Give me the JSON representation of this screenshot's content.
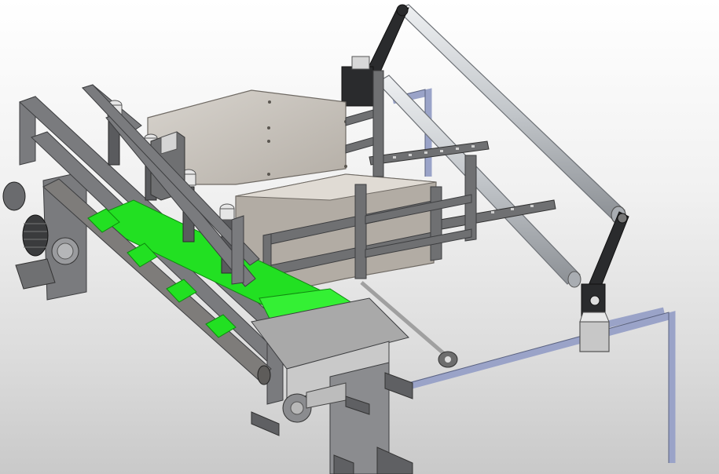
{
  "colors": {
    "background_top": "#ffffff",
    "background_bottom": "#c9c9c9",
    "frame_steel": "#6f7072",
    "frame_dark": "#3d3e40",
    "panel_sheet": "#c9c4bd",
    "roller": "#bfc3c7",
    "belt_green": "#22e022",
    "rail_blue_steel": "#9aa3c8",
    "arm_black": "#2a2b2d"
  },
  "icons": {
    "scene": "cad-3d-conveyor-machine-icon"
  }
}
